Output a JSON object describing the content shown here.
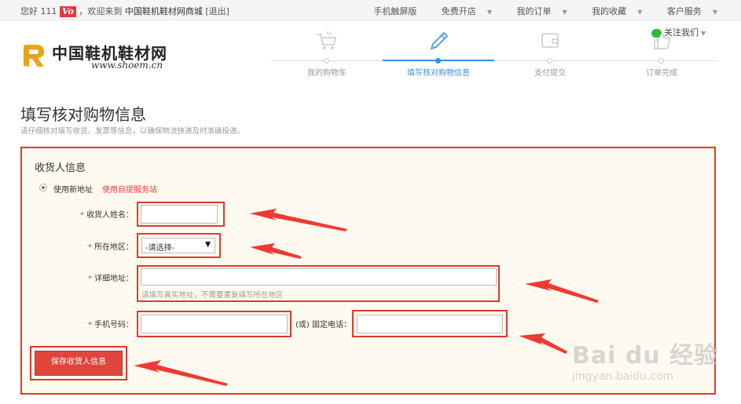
{
  "topbar": {
    "greeting": "您好 111",
    "badge": "Vo",
    "welcome": "，欢迎来到",
    "mall_name": "中国鞋机鞋材网商城",
    "logout": "[退出]",
    "links": [
      {
        "label": "手机触屏版"
      },
      {
        "label": "免费开店"
      },
      {
        "label": "我的订单"
      },
      {
        "label": "我的收藏"
      },
      {
        "label": "客户服务"
      }
    ]
  },
  "header": {
    "logo_title": "中国鞋机鞋材网",
    "logo_url": "www.shoem.cn",
    "wechat": "关注我们"
  },
  "steps": [
    {
      "label": "我的购物车",
      "icon": "cart-icon"
    },
    {
      "label": "填写核对购物信息",
      "icon": "pencil-icon",
      "active": true
    },
    {
      "label": "支付提交",
      "icon": "wallet-icon"
    },
    {
      "label": "订单完成",
      "icon": "thumbs-up-icon"
    }
  ],
  "page": {
    "title": "填写核对购物信息",
    "subtitle": "请仔细核对填写收货、发票等信息，以确保物流快递及时准确投递。"
  },
  "form": {
    "section_title": "收货人信息",
    "option_new": "使用新地址",
    "option_pickup": "使用自提服务站",
    "name_label": "收货人姓名：",
    "region_label": "所在地区：",
    "region_value": "-请选择-",
    "address_label": "详细地址：",
    "address_hint": "请填写真实地址，不需要重复填写所在地区",
    "mobile_label": "手机号码：",
    "phone_label": "(或) 固定电话：",
    "required_mark": "*",
    "save_button": "保存收货人信息"
  },
  "watermark": {
    "text": "Bai du 经验",
    "url": "jingyan.baidu.com"
  },
  "colors": {
    "accent": "#e4393c",
    "step_active": "#3a8ee6",
    "highlight": "#e0392c"
  }
}
